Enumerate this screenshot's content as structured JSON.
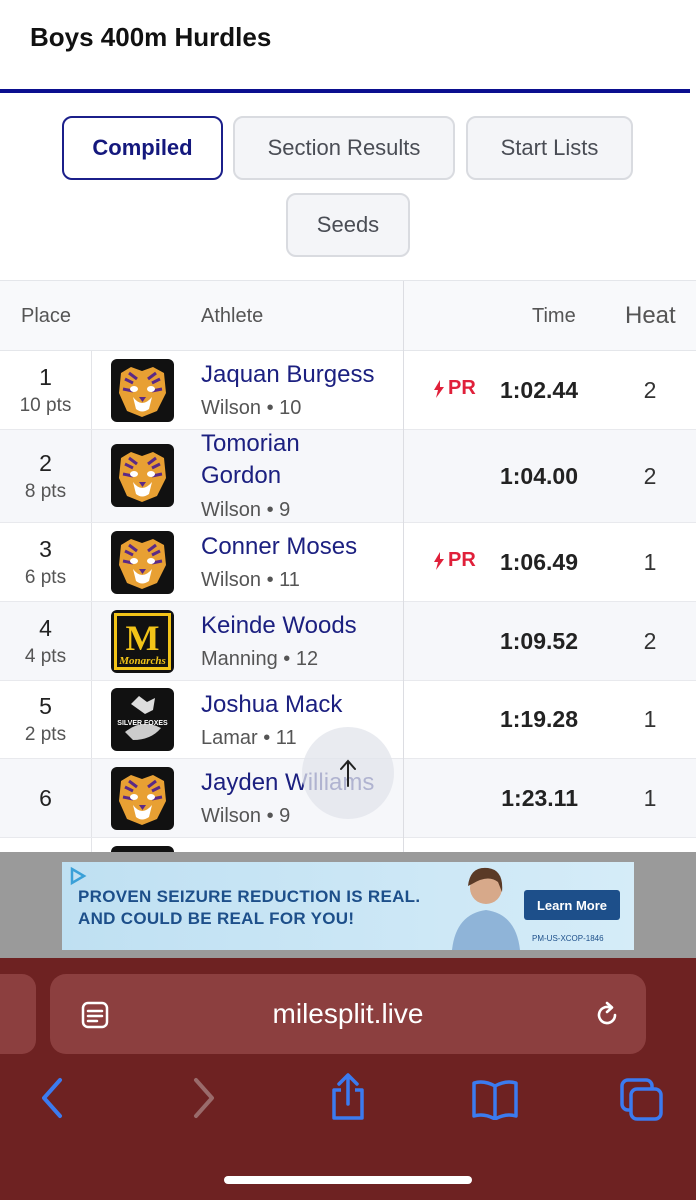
{
  "header": {
    "title": "Boys 400m Hurdles"
  },
  "tabs": [
    {
      "label": "Compiled",
      "active": true
    },
    {
      "label": "Section Results",
      "active": false
    },
    {
      "label": "Start Lists",
      "active": false
    },
    {
      "label": "Seeds",
      "active": false
    }
  ],
  "table": {
    "columns": {
      "place": "Place",
      "athlete": "Athlete",
      "time": "Time",
      "heat": "Heat"
    },
    "rows": [
      {
        "place": "1",
        "pts": "10 pts",
        "name": "Jaquan Burgess",
        "sub": "Wilson • 10",
        "pr": "PR",
        "time": "1:02.44",
        "heat": "2",
        "logo": "tiger-logo"
      },
      {
        "place": "2",
        "pts": "8 pts",
        "name_line1": "Tomorian",
        "name_line2": "Gordon",
        "sub": "Wilson • 9",
        "pr": "",
        "time": "1:04.00",
        "heat": "2",
        "logo": "tiger-logo"
      },
      {
        "place": "3",
        "pts": "6 pts",
        "name": "Conner Moses",
        "sub": "Wilson • 11",
        "pr": "PR",
        "time": "1:06.49",
        "heat": "1",
        "logo": "tiger-logo"
      },
      {
        "place": "4",
        "pts": "4 pts",
        "name": "Keinde Woods",
        "sub": "Manning • 12",
        "pr": "",
        "time": "1:09.52",
        "heat": "2",
        "logo": "monarchs-logo"
      },
      {
        "place": "5",
        "pts": "2 pts",
        "name": "Joshua Mack",
        "sub": "Lamar • 11",
        "pr": "",
        "time": "1:19.28",
        "heat": "1",
        "logo": "silver-foxes-logo"
      },
      {
        "place": "6",
        "pts": "",
        "name": "Jayden Williams",
        "sub": "Wilson • 9",
        "pr": "",
        "time": "1:23.11",
        "heat": "1",
        "logo": "tiger-logo"
      }
    ]
  },
  "logos": {
    "monarchs_letter": "M",
    "monarchs_word": "Monarchs",
    "silver_foxes": "SILVER FOXES"
  },
  "ad": {
    "line1": "PROVEN SEIZURE REDUCTION IS REAL.",
    "line2": "AND COULD BE REAL FOR YOU!",
    "button": "Learn More",
    "code": "PM-US-XCOP-1846"
  },
  "browser": {
    "url": "milesplit.live"
  },
  "colors": {
    "accent": "#1b1f8a",
    "pr": "#e0203a",
    "browser_bg": "#6e2222",
    "toolbar_icon": "#3b7bf0"
  }
}
